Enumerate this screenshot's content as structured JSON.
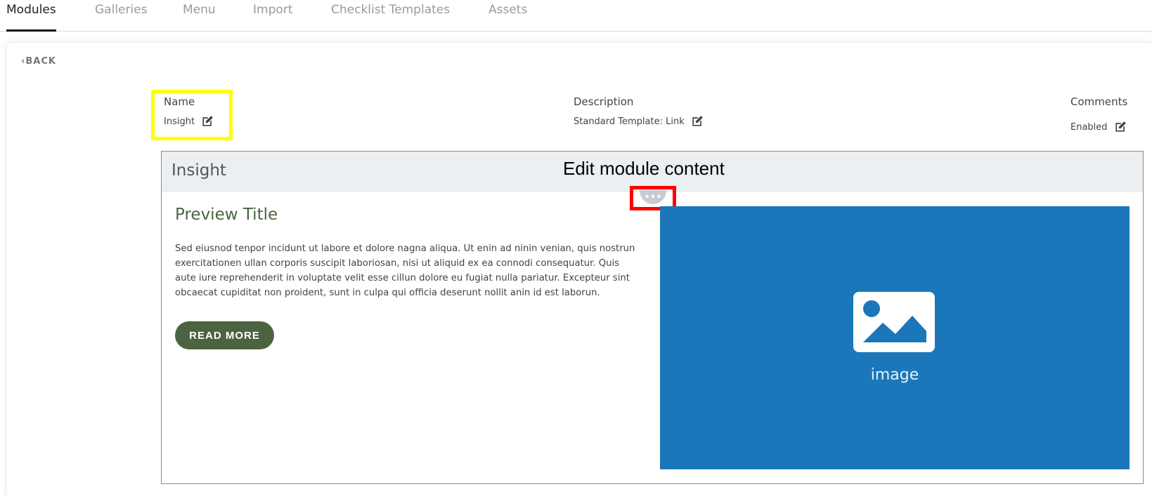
{
  "tabs": [
    {
      "label": "Modules",
      "active": true
    },
    {
      "label": "Galleries",
      "active": false
    },
    {
      "label": "Menu",
      "active": false
    },
    {
      "label": "Import",
      "active": false
    },
    {
      "label": "Checklist Templates",
      "active": false
    },
    {
      "label": "Assets",
      "active": false
    }
  ],
  "back_label": "BACK",
  "fields": {
    "name": {
      "label": "Name",
      "value": "Insight"
    },
    "description": {
      "label": "Description",
      "value": "Standard Template: Link"
    },
    "comments": {
      "label": "Comments",
      "value": "Enabled"
    }
  },
  "card": {
    "title": "Insight",
    "annotation": "Edit module content",
    "more_icon": "ellipsis-icon",
    "preview_title": "Preview Title",
    "preview_body": "Sed eiusnod tenpor incidunt ut labore et dolore nagna aliqua. Ut enin ad ninin venian, quis nostrun exercitationen ullan corporis suscipit laboriosan, nisi ut aliquid ex ea connodi consequatur. Quis aute iure reprehenderit in voluptate velit esse cillun dolore eu fugiat nulla pariatur. Excepteur sint obcaecat cupiditat non proident, sunt in culpa qui officia deserunt nollit anin id est laborun.",
    "read_more_label": "READ MORE",
    "image_label": "image"
  },
  "colors": {
    "accent_green": "#4b6340",
    "image_blue": "#1b77b9",
    "highlight_yellow": "#ffff00",
    "highlight_red": "#ff0000"
  }
}
